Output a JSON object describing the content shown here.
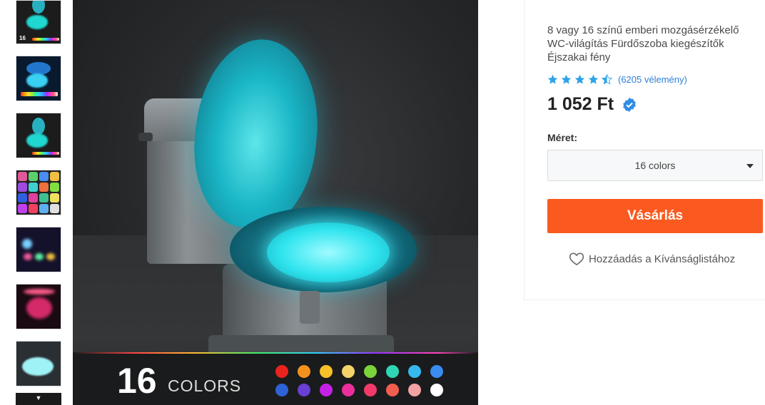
{
  "product": {
    "title": "8 vagy 16 színű emberi mozgásérzékelő WC-világítás Fürdőszoba kiegészítők Éjszakai fény",
    "rating_stars": 4.5,
    "reviews": "(6205 vélemény)",
    "price": "1 052 Ft"
  },
  "options": {
    "size_label": "Méret:",
    "size_selected": "16 colors"
  },
  "actions": {
    "buy_label": "Vásárlás",
    "wishlist_label": "Hozzáadás a Kívánságlistához"
  },
  "gallery": {
    "promo_number": "16",
    "promo_word": "COLORS",
    "thumb_caption": "16",
    "swatch_colors": [
      "#e8231e",
      "#f5921e",
      "#f7c12a",
      "#f4d46a",
      "#7bd33a",
      "#2fd6b4",
      "#36b9ee",
      "#3a8cf0",
      "#2e63d6",
      "#6a3fd4",
      "#c322e6",
      "#ea2f9c",
      "#f23a6a",
      "#f25e4e",
      "#f1a2a2",
      "#ffffff"
    ]
  },
  "colors": {
    "accent": "#fa5a1f",
    "link": "#2f7fd6",
    "star": "#2ea3e8",
    "verified": "#2f8de4"
  }
}
